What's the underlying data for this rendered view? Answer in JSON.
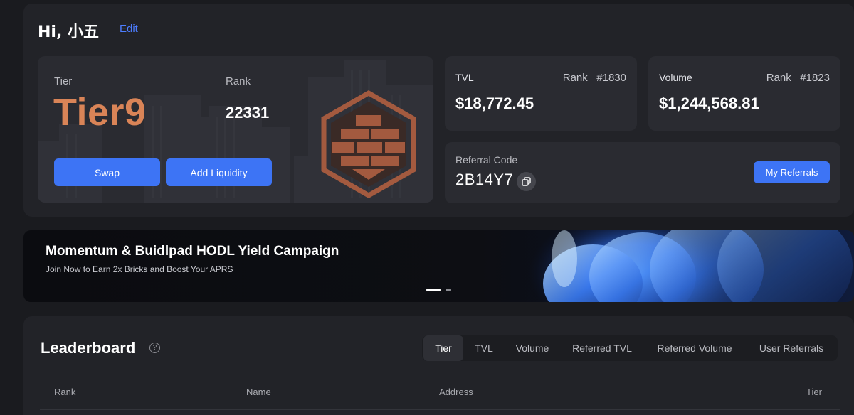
{
  "profile": {
    "greeting": "Hi, 小五",
    "edit_label": "Edit",
    "tier_label": "Tier",
    "tier_value": "Tier9",
    "rank_label": "Rank",
    "rank_value": "22331",
    "swap_label": "Swap",
    "add_liquidity_label": "Add Liquidity",
    "tier_color": "#d98457",
    "badge_icon": "brick-wall-hexagon-badge"
  },
  "stats": {
    "tvl": {
      "label": "TVL",
      "rank_label": "Rank",
      "rank_value": "#1830",
      "value": "$18,772.45"
    },
    "volume": {
      "label": "Volume",
      "rank_label": "Rank",
      "rank_value": "#1823",
      "value": "$1,244,568.81"
    }
  },
  "referral": {
    "label": "Referral Code",
    "code": "2B14Y7",
    "my_referrals_label": "My Referrals",
    "copy_icon": "copy-icon"
  },
  "banner": {
    "title": "Momentum & Buidlpad HODL Yield Campaign",
    "subtitle": "Join Now to Earn 2x Bricks and Boost Your APRS",
    "slide_count": 2,
    "active_slide": 1
  },
  "leaderboard": {
    "title": "Leaderboard",
    "help_icon": "question-circle-icon",
    "tabs": [
      {
        "label": "Tier",
        "active": true
      },
      {
        "label": "TVL",
        "active": false
      },
      {
        "label": "Volume",
        "active": false
      },
      {
        "label": "Referred TVL",
        "active": false
      },
      {
        "label": "Referred Volume",
        "active": false
      },
      {
        "label": "User Referrals",
        "active": false
      }
    ],
    "columns": [
      "Rank",
      "Name",
      "Address",
      "Tier"
    ]
  },
  "colors": {
    "accent_blue": "#3d74f5",
    "link_blue": "#4d7dff",
    "background": "#1a1b1f",
    "panel": "#222328",
    "card": "#2a2b31"
  }
}
